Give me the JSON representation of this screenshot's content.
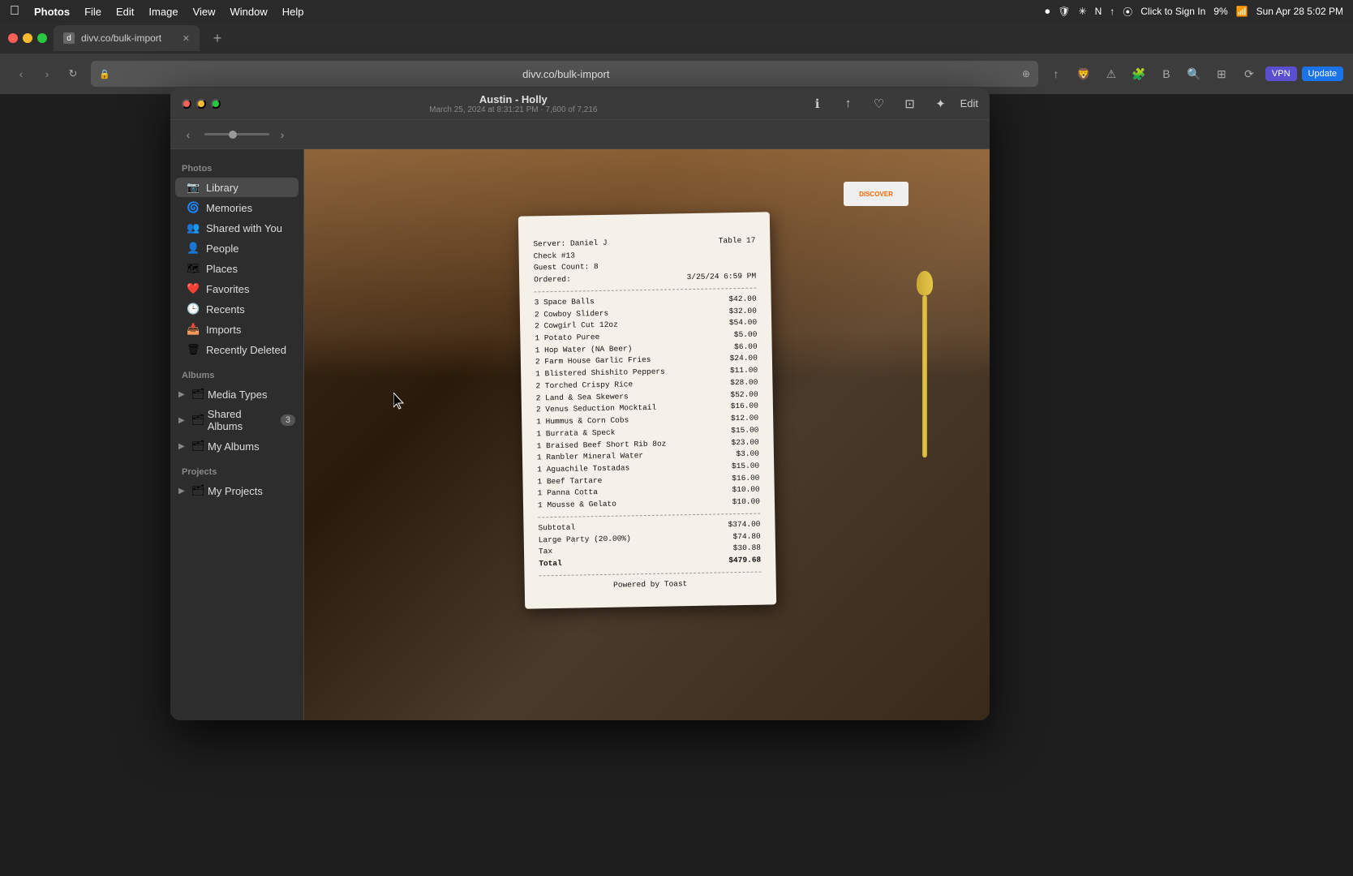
{
  "menubar": {
    "apple": "⌘",
    "items": [
      "Photos",
      "File",
      "Edit",
      "Image",
      "View",
      "Window",
      "Help"
    ],
    "right": {
      "click_to_sign_in": "Click to Sign In",
      "battery": "9%",
      "datetime": "Sun Apr 28  5:02 PM"
    }
  },
  "browser": {
    "tab": {
      "favicon": "d",
      "title": "divv.co/bulk-import",
      "url": "divv.co/bulk-import"
    },
    "nav": {
      "back_disabled": true,
      "forward_disabled": true
    },
    "buttons": {
      "vpn": "VPN",
      "update": "Update"
    }
  },
  "photos_window": {
    "title": "Austin - Holly",
    "subtitle": "March 25, 2024 at 8:31:21 PM · 7,600 of 7,216",
    "slider_nav": "◀",
    "edit_label": "Edit",
    "sidebar": {
      "photos_section": "Photos",
      "items": [
        {
          "id": "library",
          "icon": "📷",
          "label": "Library",
          "active": true
        },
        {
          "id": "memories",
          "icon": "🌀",
          "label": "Memories"
        },
        {
          "id": "shared-with-you",
          "icon": "👥",
          "label": "Shared with You"
        },
        {
          "id": "people",
          "icon": "👤",
          "label": "People"
        },
        {
          "id": "places",
          "icon": "🗺",
          "label": "Places"
        },
        {
          "id": "favorites",
          "icon": "❤️",
          "label": "Favorites"
        },
        {
          "id": "recents",
          "icon": "🕒",
          "label": "Recents"
        },
        {
          "id": "imports",
          "icon": "📥",
          "label": "Imports"
        },
        {
          "id": "recently-deleted",
          "icon": "🗑",
          "label": "Recently Deleted"
        }
      ],
      "albums_section": "Albums",
      "albums": [
        {
          "id": "media-types",
          "label": "Media Types",
          "expandable": true
        },
        {
          "id": "shared-albums",
          "label": "Shared Albums",
          "expandable": true,
          "badge": "3"
        },
        {
          "id": "my-albums",
          "label": "My Albums",
          "expandable": true
        }
      ],
      "projects_section": "Projects",
      "projects": [
        {
          "id": "my-projects",
          "label": "My Projects",
          "expandable": true
        }
      ]
    },
    "receipt": {
      "server": "Server: Daniel J",
      "check": "Check #13",
      "table": "Table 17",
      "guest_count": "Guest Count: 8",
      "ordered": "Ordered:",
      "ordered_date": "3/25/24 6:59 PM",
      "items": [
        {
          "qty": "3",
          "name": "Space Balls",
          "price": "$42.00"
        },
        {
          "qty": "2",
          "name": "Cowboy Sliders",
          "price": "$32.00"
        },
        {
          "qty": "2",
          "name": "Cowgirl Cut 12oz",
          "price": "$54.00"
        },
        {
          "qty": "1",
          "name": "Potato Puree",
          "price": "$5.00"
        },
        {
          "qty": "1",
          "name": "Hop Water (NA Beer)",
          "price": "$6.00"
        },
        {
          "qty": "2",
          "name": "Farm House Garlic Fries",
          "price": "$24.00"
        },
        {
          "qty": "1",
          "name": "Blistered Shishito Peppers",
          "price": "$11.00"
        },
        {
          "qty": "2",
          "name": "Torched Crispy Rice",
          "price": "$28.00"
        },
        {
          "qty": "2",
          "name": "Land & Sea Skewers",
          "price": "$52.00"
        },
        {
          "qty": "2",
          "name": "Venus Seduction Mocktail",
          "price": "$16.00"
        },
        {
          "qty": "1",
          "name": "Hummus & Corn Cobs",
          "price": "$12.00"
        },
        {
          "qty": "1",
          "name": "Burrata & Speck",
          "price": "$15.00"
        },
        {
          "qty": "1",
          "name": "Braised Beef Short Rib 8oz",
          "price": "$23.00"
        },
        {
          "qty": "1",
          "name": "Ranbler Mineral Water",
          "price": "$3.00"
        },
        {
          "qty": "1",
          "name": "Aguachile Tostadas",
          "price": "$15.00"
        },
        {
          "qty": "1",
          "name": "Beef Tartare",
          "price": "$16.00"
        },
        {
          "qty": "1",
          "name": "Panna Cotta",
          "price": "$10.00"
        },
        {
          "qty": "1",
          "name": "Mousse & Gelato",
          "price": "$10.00"
        }
      ],
      "subtotal_label": "Subtotal",
      "subtotal_value": "$374.00",
      "large_party_label": "Large Party (20.00%)",
      "large_party_value": "$74.80",
      "tax_label": "Tax",
      "tax_value": "$30.88",
      "total_label": "Total",
      "total_value": "$479.68",
      "powered_by": "Powered by Toast"
    }
  }
}
